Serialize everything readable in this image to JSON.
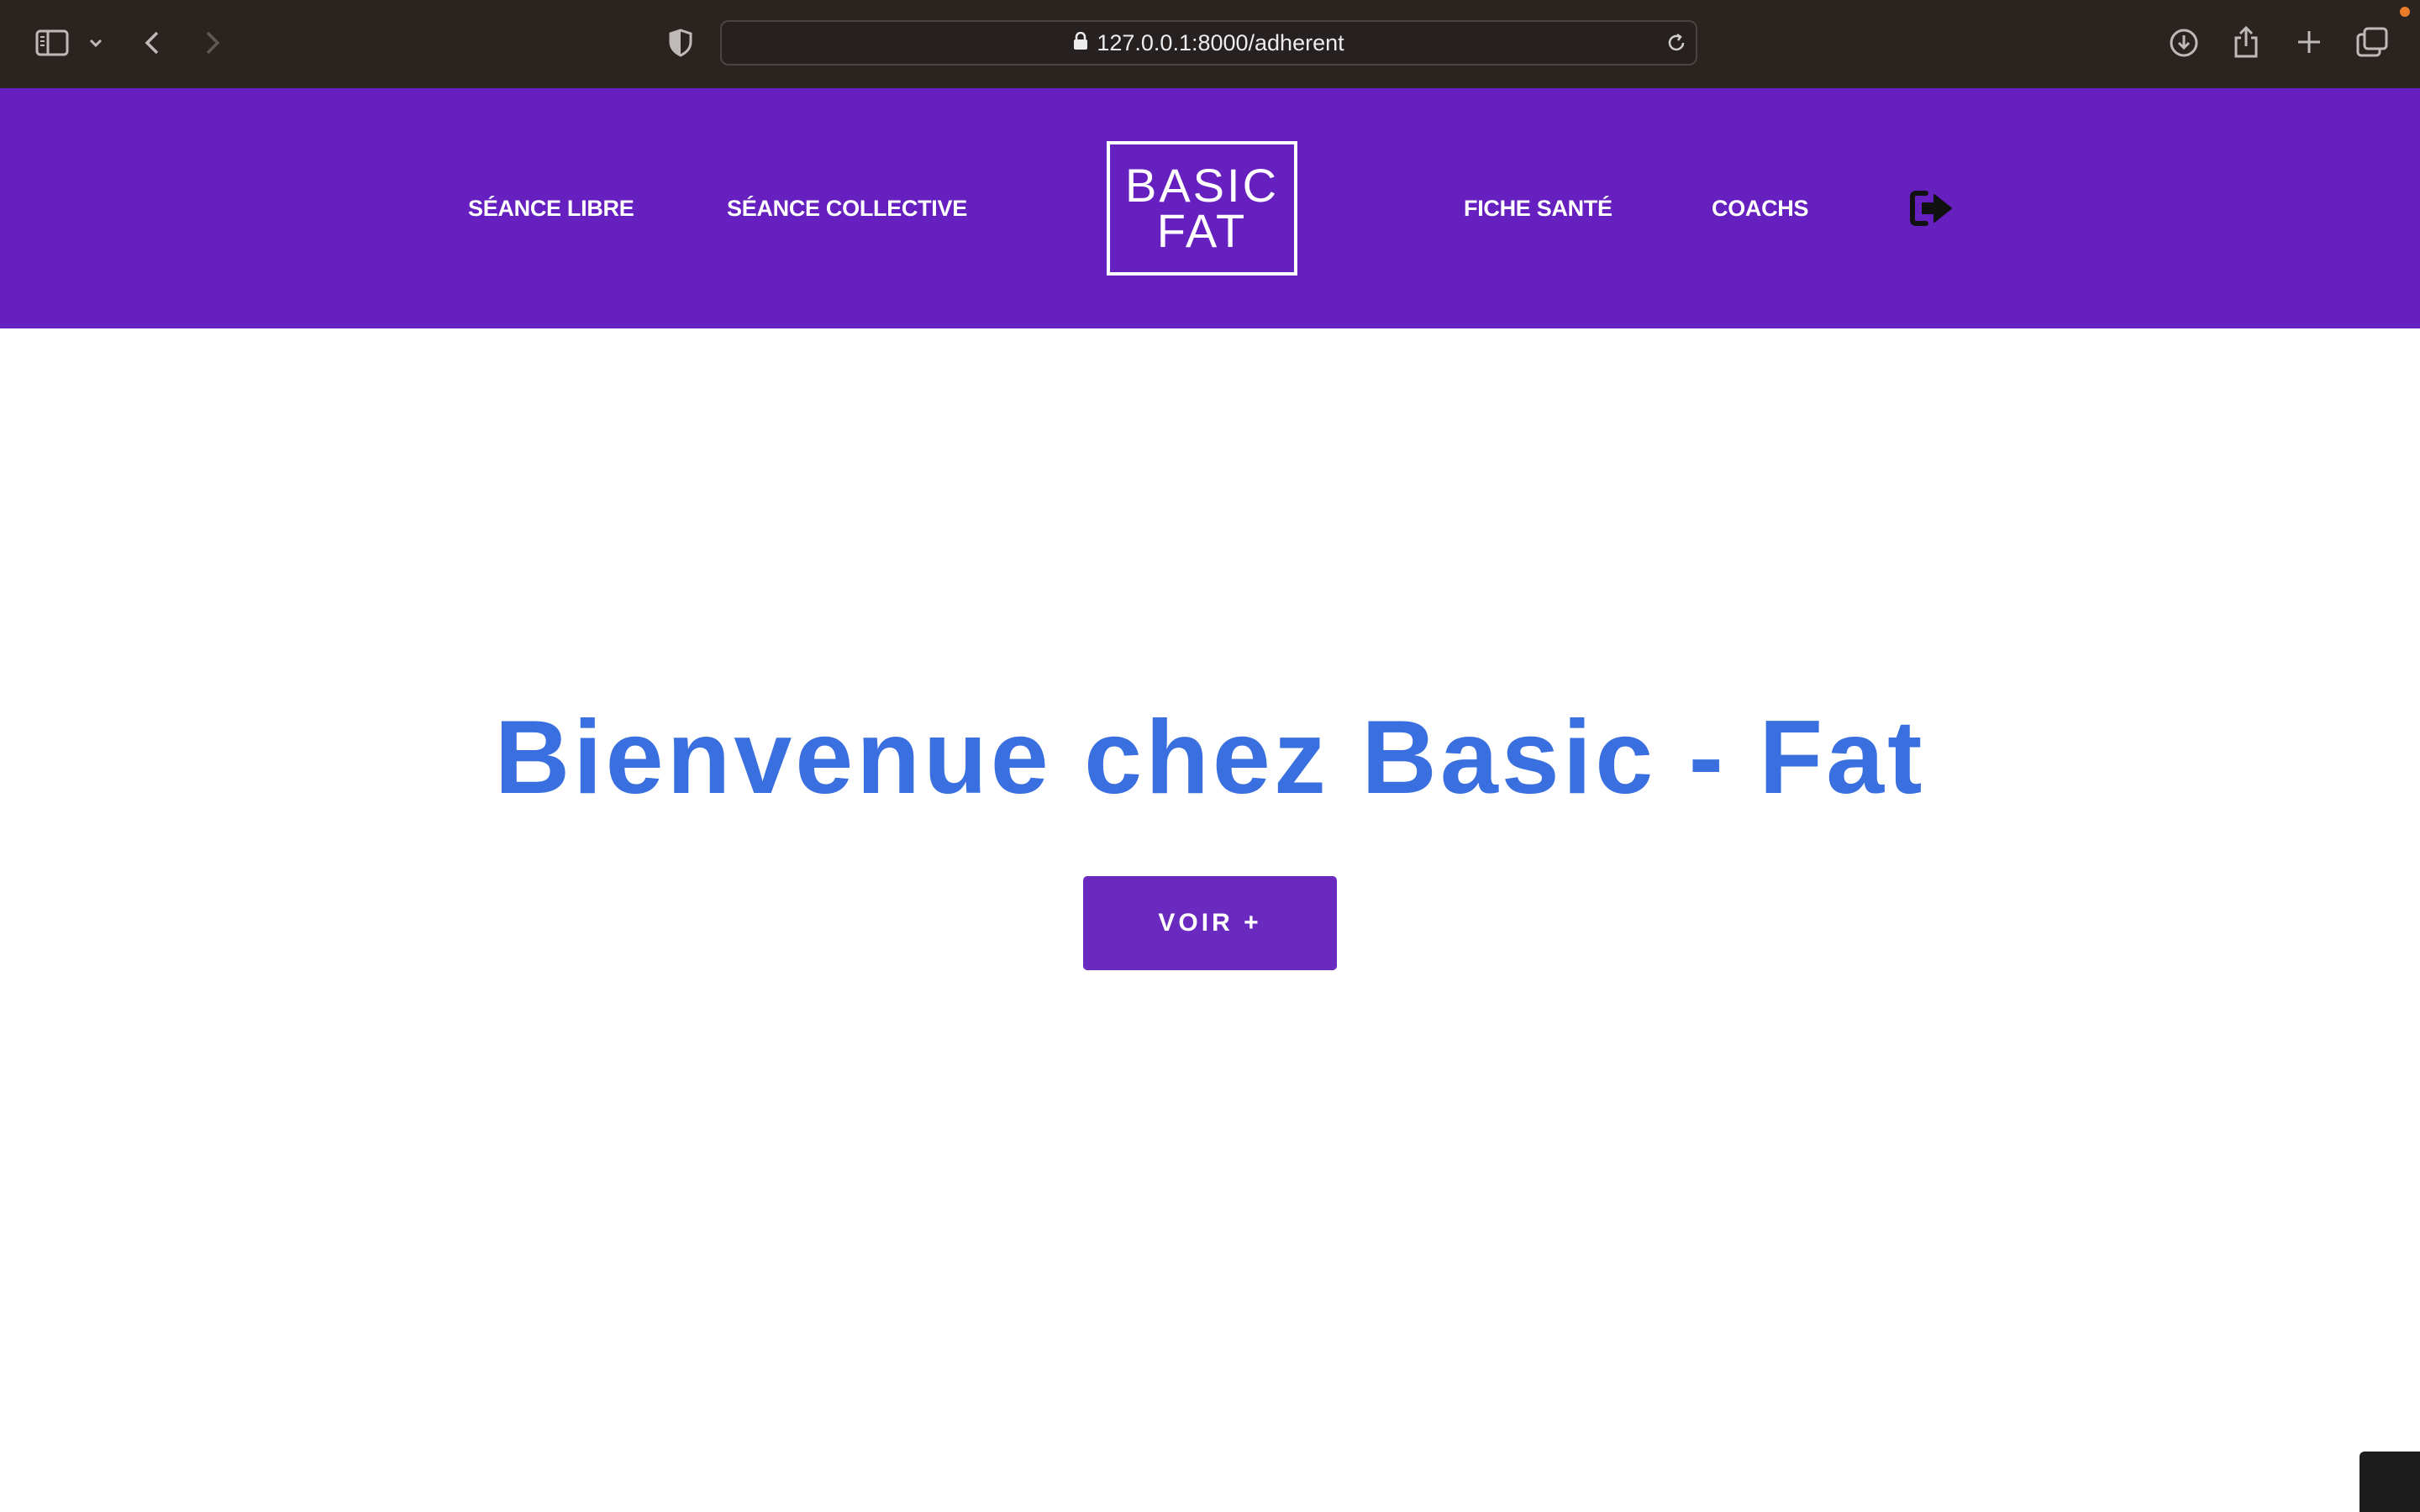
{
  "browser": {
    "url": "127.0.0.1:8000/adherent",
    "icons": [
      "sidebar-icon",
      "chevron-down-icon",
      "back-icon",
      "forward-icon",
      "shield-icon",
      "lock-icon",
      "reload-icon",
      "download-icon",
      "share-icon",
      "new-tab-icon",
      "tabs-overview-icon"
    ]
  },
  "header": {
    "nav_left": [
      "SÉANCE LIBRE",
      "SÉANCE COLLECTIVE"
    ],
    "logo_line1": "BASIC",
    "logo_line2": "FAT",
    "nav_right": [
      "FICHE SANTÉ",
      "COACHS"
    ],
    "logout_icon": "logout-icon"
  },
  "hero": {
    "title": "Bienvenue chez Basic - Fat",
    "button_label": "VOIR +"
  },
  "colors": {
    "header_bg": "#6620bf",
    "title": "#3a6fdf",
    "button_bg": "#6a2ac0",
    "browser_bar": "#2a2320"
  }
}
